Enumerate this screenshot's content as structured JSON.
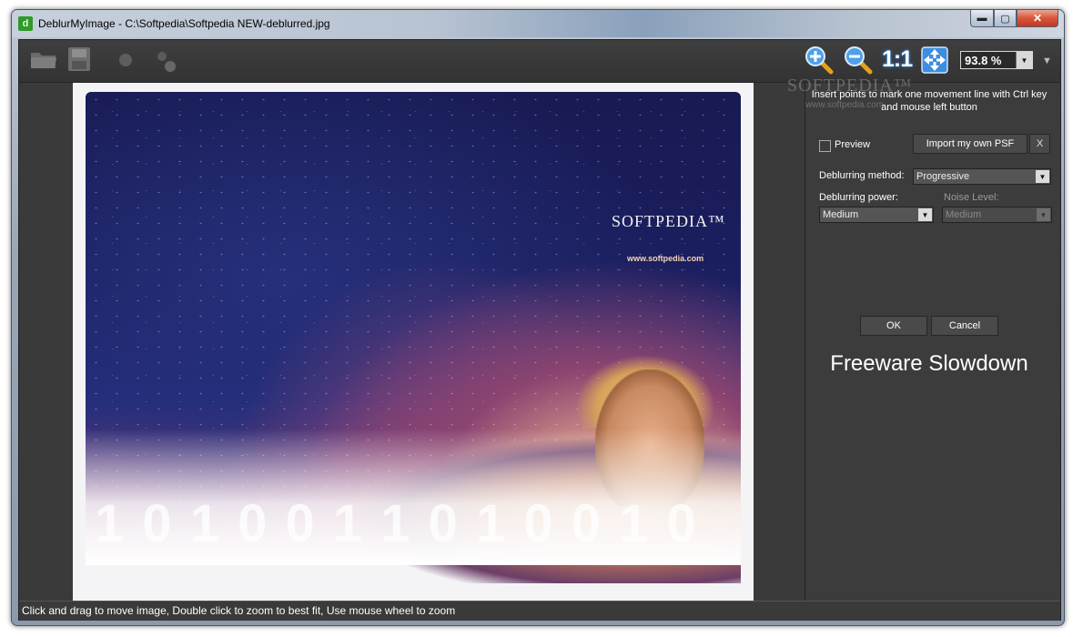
{
  "window": {
    "title": "DeblurMyImage - C:\\Softpedia\\Softpedia NEW-deblurred.jpg",
    "app_icon_letter": "d",
    "caption": {
      "minimize": "▬",
      "maximize": "▢",
      "close": "✕"
    }
  },
  "toolbar": {
    "icons": [
      "folder-icon",
      "save-icon",
      "record-dot-icon",
      "points-icon",
      "zoom-in-icon",
      "zoom-out-icon",
      "actual-size-icon",
      "fit-to-window-icon"
    ],
    "actual_size_label": "1:1",
    "zoom_value": "93.8 %",
    "zoom_dropdown_arrow": "▼",
    "menu_arrow": "▼"
  },
  "image": {
    "logo_text": "SOFTPEDIA™",
    "logo_url": "www.softpedia.com",
    "binary_text": "1 0 1 0 0 1 1 0 1 0 0 1 0"
  },
  "panel": {
    "watermark_logo": "SOFTPEDIA™",
    "watermark_url": "www.softpedia.com",
    "instructions": "Insert points to mark one movement line with Ctrl key and mouse left button",
    "preview_label": "Preview",
    "preview_checked": false,
    "import_psf_label": "Import my own PSF",
    "clear_psf_label": "X",
    "method_label": "Deblurring method:",
    "method_value": "Progressive",
    "power_label": "Deblurring power:",
    "power_value": "Medium",
    "noise_label": "Noise Level:",
    "noise_value": "Medium",
    "ok_label": "OK",
    "cancel_label": "Cancel",
    "slowdown_text": "Freeware Slowdown"
  },
  "status": {
    "text": "Click and drag to move image, Double click to zoom to best fit, Use mouse wheel to zoom"
  }
}
